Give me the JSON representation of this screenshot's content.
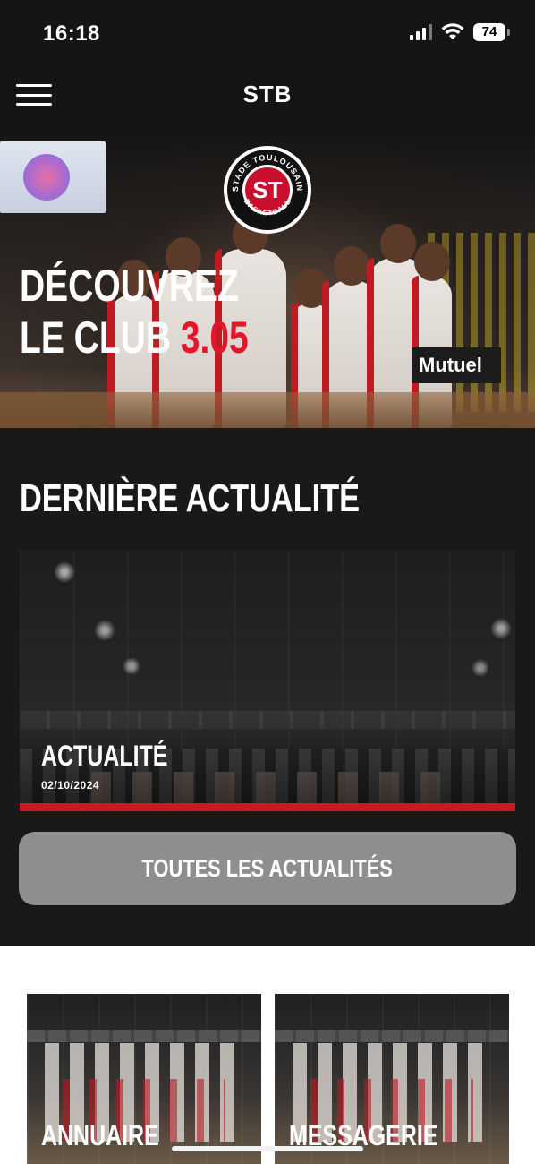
{
  "status_bar": {
    "time": "16:18",
    "battery": "74",
    "icons": [
      "signal-icon",
      "wifi-icon",
      "battery-icon"
    ]
  },
  "navbar": {
    "title": "STB",
    "menu_icon": "hamburger-menu-icon"
  },
  "hero": {
    "logo_ring_top": "STADE TOULOUSAIN",
    "logo_ring_bottom": "BASKETBALL",
    "logo_monogram": "ST",
    "line1": "DÉCOUVREZ",
    "line2": "LE CLUB",
    "accent": "3.05",
    "sign_text": "Mutuel"
  },
  "news_section": {
    "title": "DERNIÈRE ACTUALITÉ",
    "card": {
      "category": "ACTUALITÉ",
      "date": "02/10/2024"
    },
    "all_button": "TOUTES LES ACTUALITÉS"
  },
  "tiles": [
    {
      "label": "ANNUAIRE"
    },
    {
      "label": "MESSAGERIE"
    }
  ],
  "colors": {
    "accent_red": "#e3162b",
    "background": "#1a1818",
    "button_grey": "#8e8e8e"
  }
}
